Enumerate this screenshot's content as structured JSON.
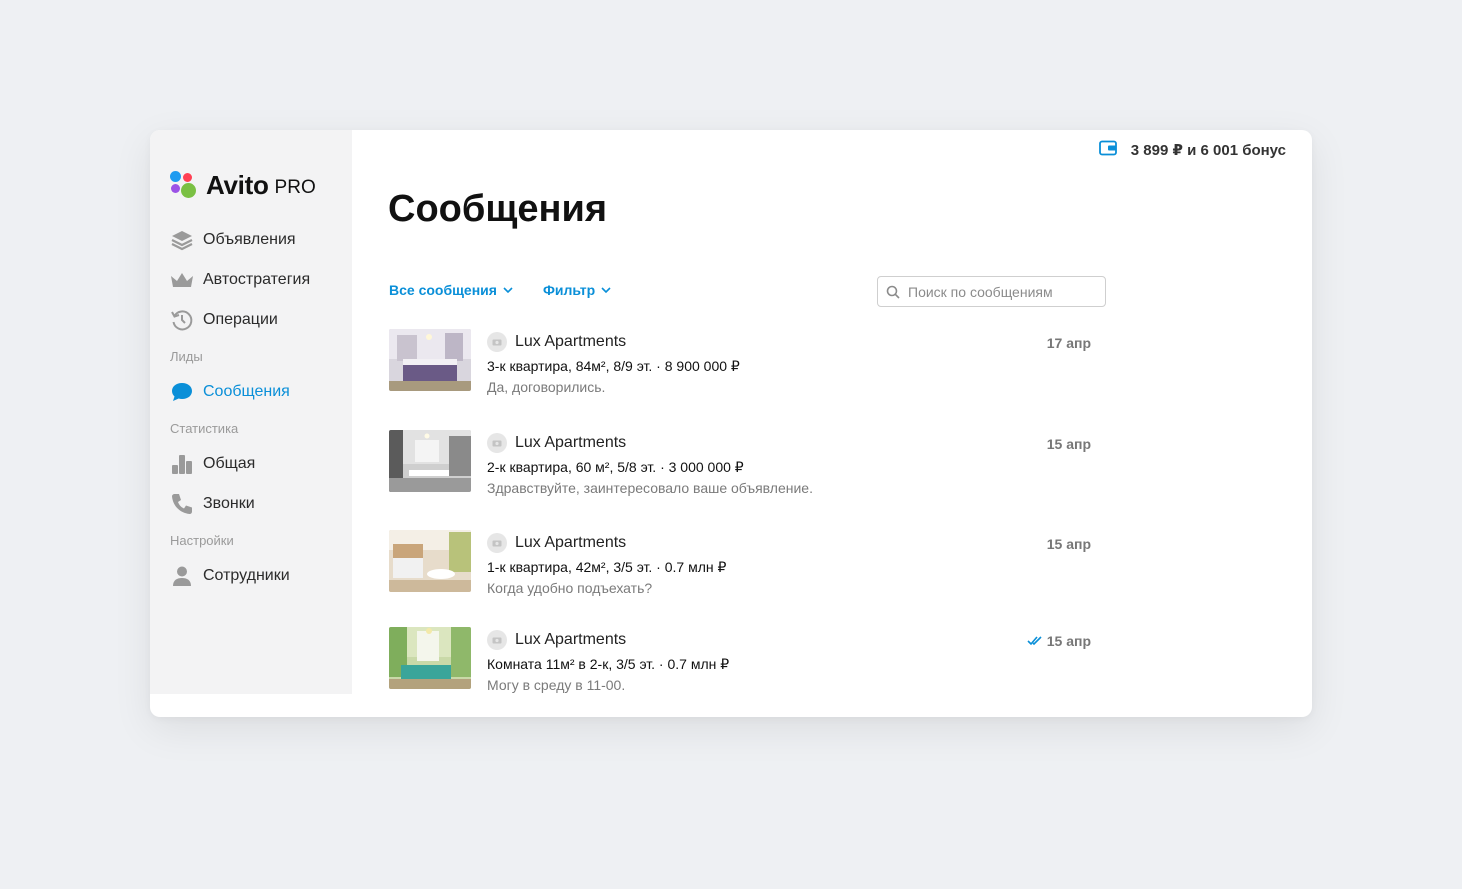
{
  "app": {
    "brand": "Avito",
    "brand_suffix": "PRO"
  },
  "balance": {
    "text": "3 899 ₽ и 6 001 бонус"
  },
  "sidebar": {
    "items": [
      {
        "label": "Объявления",
        "icon": "layers-icon"
      },
      {
        "label": "Автостратегия",
        "icon": "crown-icon"
      },
      {
        "label": "Операции",
        "icon": "history-icon"
      }
    ],
    "section_leads": "Лиды",
    "messages_label": "Сообщения",
    "section_stats": "Статистика",
    "stats_items": [
      {
        "label": "Общая",
        "icon": "bar-chart-icon"
      },
      {
        "label": "Звонки",
        "icon": "phone-icon"
      }
    ],
    "section_settings": "Настройки",
    "employees_label": "Сотрудники"
  },
  "main": {
    "title": "Сообщения",
    "filter_all": "Все сообщения",
    "filter": "Фильтр",
    "search_placeholder": "Поиск по сообщениям"
  },
  "messages": [
    {
      "sender": "Lux Apartments",
      "ad": "3-к квартира, 84м², 8/9 эт.  ·  8 900 000 ₽",
      "preview": "Да, договорились.",
      "date": "17 апр",
      "read": false
    },
    {
      "sender": "Lux Apartments",
      "ad": "2-к квартира, 60 м², 5/8 эт. · 3 000 000 ₽",
      "preview": "Здравствуйте, заинтересовало ваше объявление.",
      "date": "15 апр",
      "read": false
    },
    {
      "sender": "Lux Apartments",
      "ad": "1-к квартира, 42м², 3/5 эт.  ·  0.7 млн ₽",
      "preview": "Когда удобно подъехать?",
      "date": "15 апр",
      "read": false
    },
    {
      "sender": "Lux Apartments",
      "ad": "Комната 11м² в 2-к, 3/5 эт.  ·  0.7 млн ₽",
      "preview": "Могу в среду в 11-00.",
      "date": "15 апр",
      "read": true
    }
  ],
  "colors": {
    "accent": "#0a8fd8",
    "sidebar_bg": "#f3f3f4",
    "page_bg": "#eef0f3"
  }
}
